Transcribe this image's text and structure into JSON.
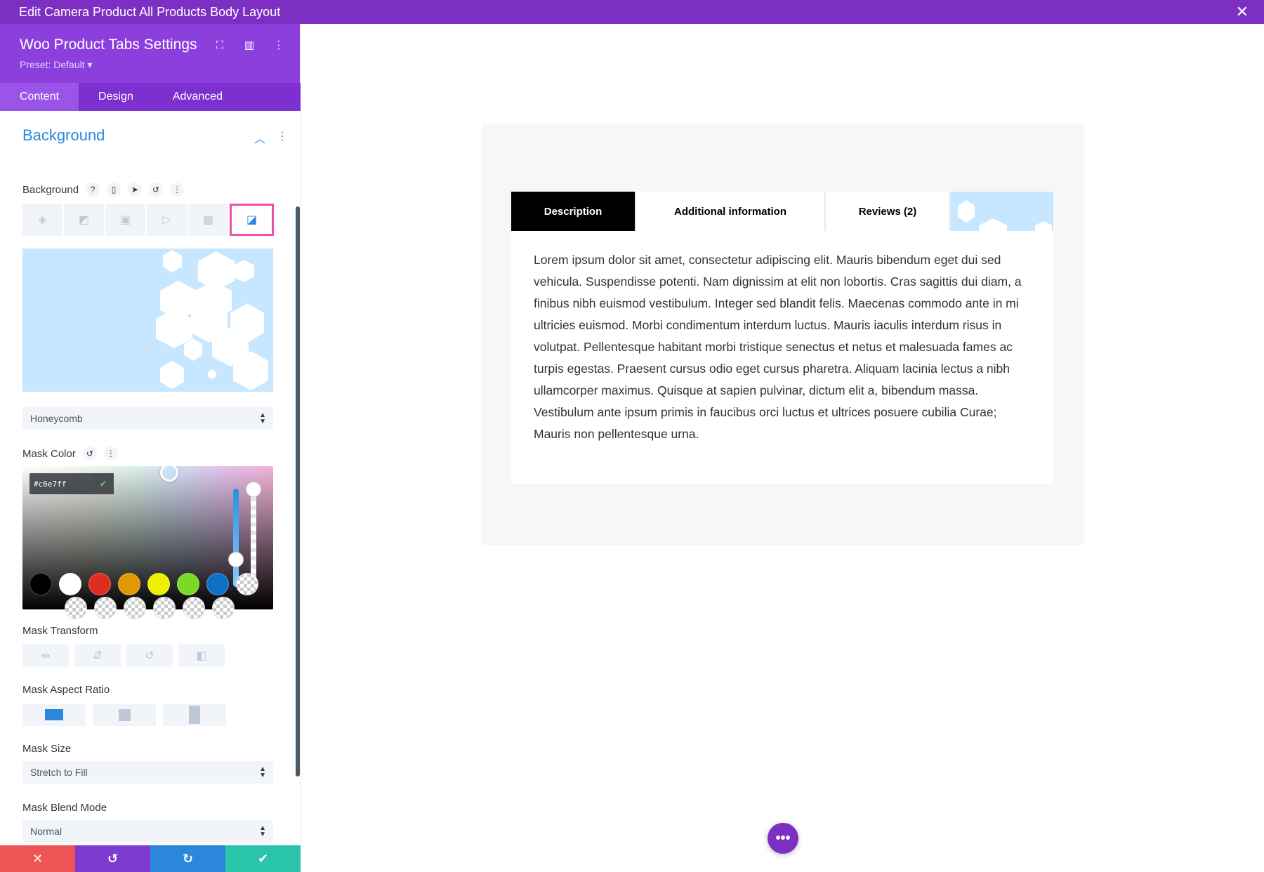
{
  "window": {
    "title": "Edit Camera Product All Products Body Layout"
  },
  "panel": {
    "title": "Woo Product Tabs Settings",
    "preset": "Preset: Default",
    "tabs": [
      {
        "label": "Content",
        "active": true
      },
      {
        "label": "Design",
        "active": false
      },
      {
        "label": "Advanced",
        "active": false
      }
    ]
  },
  "background": {
    "section_title": "Background",
    "field_label": "Background",
    "types": [
      "color",
      "gradient",
      "image",
      "video",
      "pattern",
      "mask"
    ],
    "selected_type": "mask",
    "mask_style": "Honeycomb"
  },
  "mask_color": {
    "label": "Mask Color",
    "hex": "#c6e7ff",
    "swatches": [
      "#000000",
      "#ffffff",
      "#e02b20",
      "#e09900",
      "#edf000",
      "#7cda24",
      "#0c71c3",
      "transparent"
    ],
    "extra_swatches": [
      "transparent",
      "transparent",
      "transparent",
      "transparent",
      "transparent",
      "transparent"
    ]
  },
  "mask_transform": {
    "label": "Mask Transform"
  },
  "mask_aspect_ratio": {
    "label": "Mask Aspect Ratio",
    "selected": "landscape"
  },
  "mask_size": {
    "label": "Mask Size",
    "value": "Stretch to Fill"
  },
  "mask_blend": {
    "label": "Mask Blend Mode",
    "value": "Normal"
  },
  "footer": {
    "colors": [
      "#ef5555",
      "#7e3bd0",
      "#2b87da",
      "#29c4a9"
    ]
  },
  "preview": {
    "tabs": [
      {
        "label": "Description",
        "active": true
      },
      {
        "label": "Additional information",
        "active": false
      },
      {
        "label": "Reviews (2)",
        "active": false
      }
    ],
    "body": "Lorem ipsum dolor sit amet, consectetur adipiscing elit. Mauris bibendum eget dui sed vehicula. Suspendisse potenti. Nam dignissim at elit non lobortis. Cras sagittis dui diam, a finibus nibh euismod vestibulum. Integer sed blandit felis. Maecenas commodo ante in mi ultricies euismod. Morbi condimentum interdum luctus. Mauris iaculis interdum risus in volutpat. Pellentesque habitant morbi tristique senectus et netus et malesuada fames ac turpis egestas. Praesent cursus odio eget cursus pharetra. Aliquam lacinia lectus a nibh ullamcorper maximus. Quisque at sapien pulvinar, dictum elit a, bibendum massa. Vestibulum ante ipsum primis in faucibus orci luctus et ultrices posuere cubilia Curae; Mauris non pellentesque urna."
  }
}
